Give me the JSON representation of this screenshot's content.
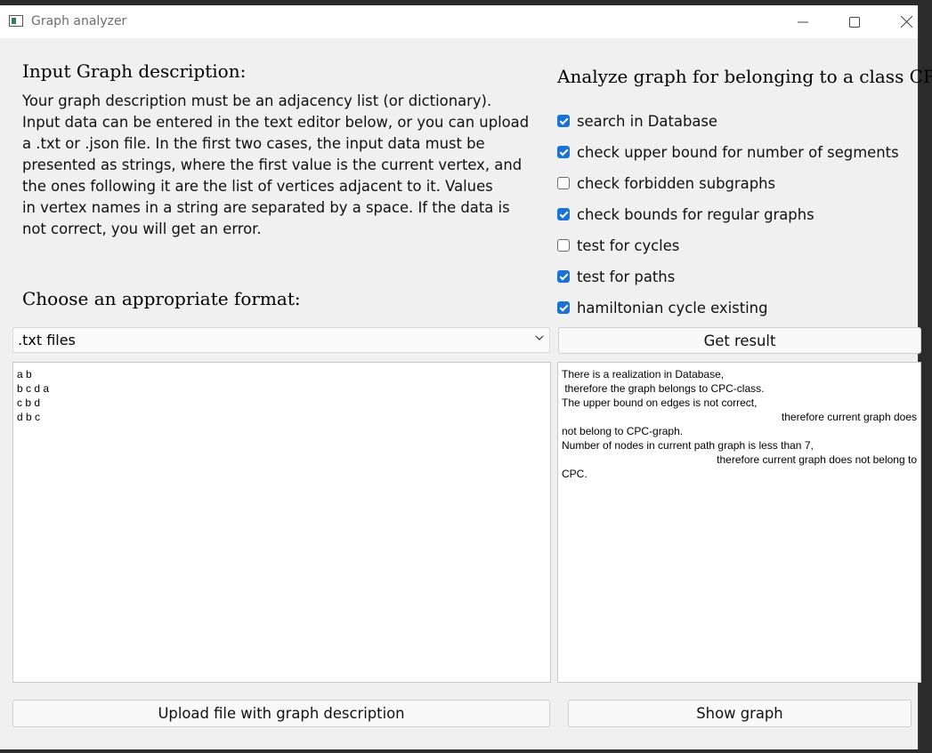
{
  "window": {
    "title": "Graph analyzer"
  },
  "input": {
    "heading": "Input Graph description:",
    "description": "Your graph description must be an adjacency list (or dictionary).\nInput data can be entered in the text editor below, or you can upload\na .txt or .json file. In the first two cases, the input data must be\npresented as strings, where the first value is the current vertex, and\nthe ones following it are the list of vertices adjacent to it. Values\nin vertex names in a string are separated by a space. If the data is\nnot correct, you will get an error.",
    "format_heading": "Choose an appropriate format:",
    "format_selected": ".txt files",
    "editor_lines": [
      "a b",
      "b c d a",
      "c b d",
      "d b c"
    ],
    "upload_button": "Upload file with graph description"
  },
  "analyze": {
    "heading": "Analyze graph for belonging to a class CPC:",
    "options": [
      {
        "label": "search in Database",
        "checked": true
      },
      {
        "label": "check upper bound for number of segments",
        "checked": true
      },
      {
        "label": "check forbidden subgraphs",
        "checked": false
      },
      {
        "label": "check bounds for regular graphs",
        "checked": true
      },
      {
        "label": "test for cycles",
        "checked": false
      },
      {
        "label": "test for paths",
        "checked": true
      },
      {
        "label": "hamiltonian cycle existing",
        "checked": true
      }
    ],
    "get_result_button": "Get result",
    "result_lines": [
      "There is a realization in Database,",
      " therefore the graph belongs to CPC-class.",
      "The upper bound on edges is not correct,",
      "therefore current graph does",
      "not belong to CPC-graph.",
      "Number of nodes in current path graph is less than 7,",
      "therefore current graph does not belong to",
      "CPC."
    ],
    "show_graph_button": "Show graph"
  }
}
